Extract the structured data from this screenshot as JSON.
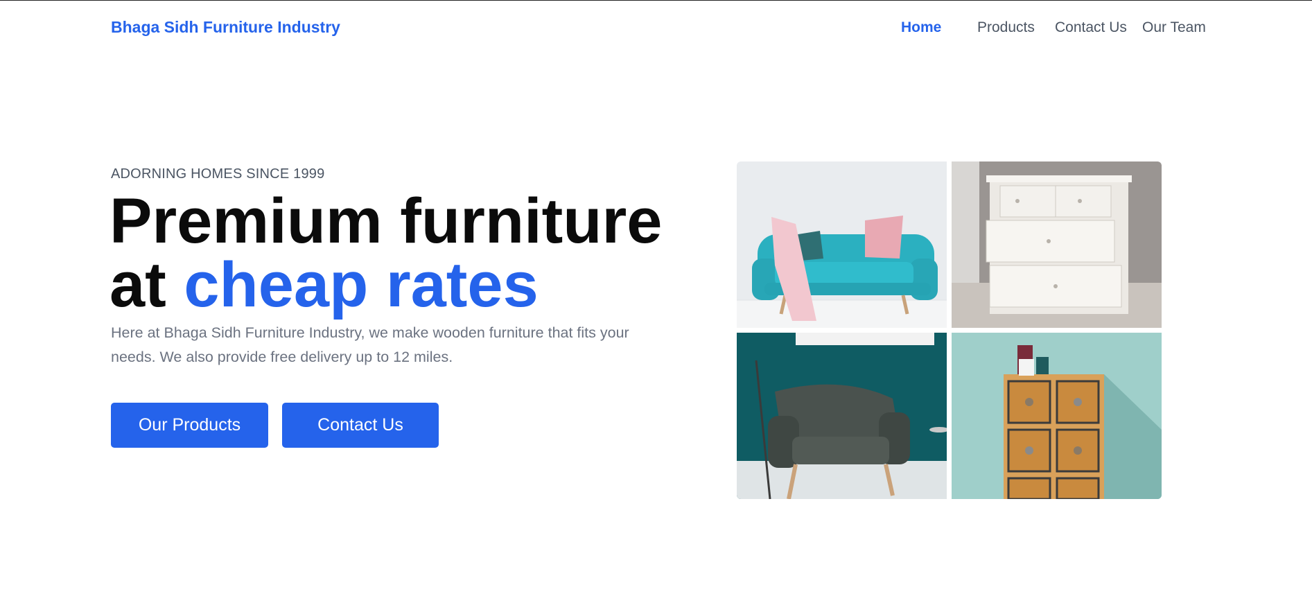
{
  "header": {
    "brand": "Bhaga Sidh Furniture Industry",
    "nav": [
      {
        "label": "Home",
        "active": true
      },
      {
        "label": "Products",
        "active": false
      },
      {
        "label": "Contact Us",
        "active": false
      },
      {
        "label": "Our Team",
        "active": false
      }
    ]
  },
  "hero": {
    "eyebrow": "ADORNING HOMES SINCE 1999",
    "headline_line1": "Premium furniture",
    "headline_line2_prefix": "at",
    "headline_line2_accent": "cheap rates",
    "description": "Here at Bhaga Sidh Furniture Industry, we make wooden furniture that fits your needs. We also provide free delivery up to 12 miles.",
    "buttons": {
      "products": "Our Products",
      "contact": "Contact Us"
    }
  },
  "gallery": {
    "images": [
      {
        "icon": "teal-sofa-image"
      },
      {
        "icon": "white-dresser-image"
      },
      {
        "icon": "green-armchair-image"
      },
      {
        "icon": "wooden-cabinet-image"
      }
    ]
  },
  "colors": {
    "accent": "#2563eb",
    "text_dark": "#0b0b0b",
    "text_muted": "#6b7280"
  }
}
